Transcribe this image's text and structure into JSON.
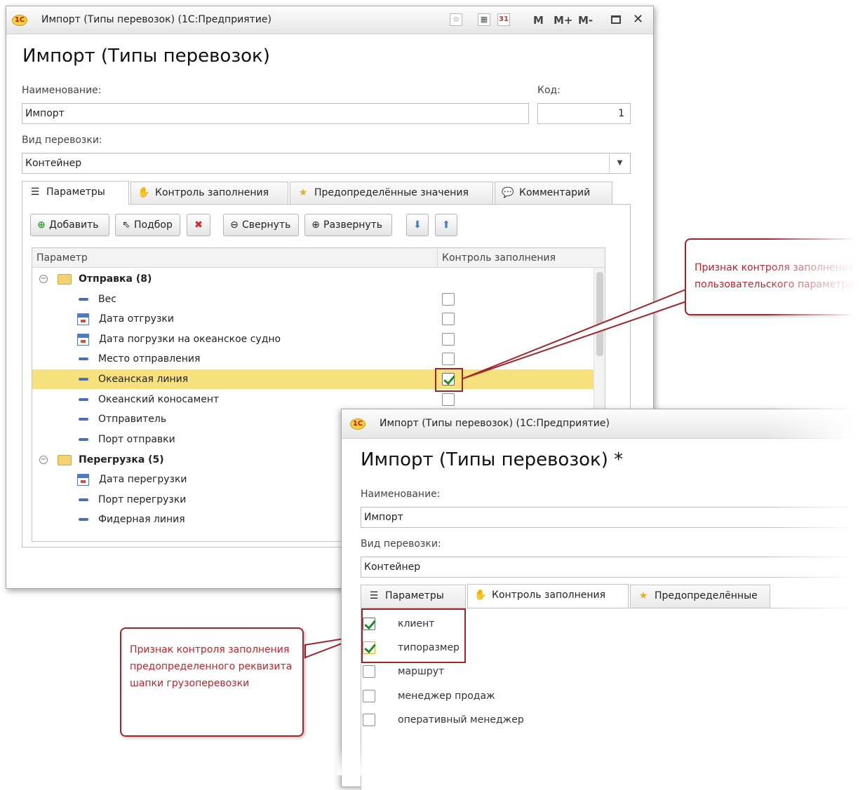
{
  "win1": {
    "title": "Импорт (Типы перевозок)  (1С:Предприятие)",
    "logo": "1С",
    "toolbar": {
      "m": "M",
      "m_plus": "M+",
      "m_minus": "M-",
      "close": "✕",
      "cal_day": "31"
    },
    "heading": "Импорт (Типы перевозок)",
    "name_label": "Наименование:",
    "name_value": "Импорт",
    "code_label": "Код:",
    "code_value": "1",
    "kind_label": "Вид перевозки:",
    "kind_value": "Контейнер",
    "tabs": [
      "Параметры",
      "Контроль заполнения",
      "Предопределённые значения",
      "Комментарий"
    ],
    "buttons": {
      "add": "Добавить",
      "pick": "Подбор",
      "collapse": "Свернуть",
      "expand": "Развернуть"
    },
    "columns": [
      "Параметр",
      "Контроль заполнения"
    ],
    "groups": [
      {
        "label": "Отправка (8)"
      },
      {
        "label": "Перегрузка (5)"
      }
    ],
    "rows": [
      {
        "label": "Вес",
        "icon": "dash",
        "checked": false
      },
      {
        "label": "Дата отгрузки",
        "icon": "calendar",
        "checked": false
      },
      {
        "label": "Дата погрузки на океанское судно",
        "icon": "calendar",
        "checked": false
      },
      {
        "label": "Место отправления",
        "icon": "dash",
        "checked": false
      },
      {
        "label": "Океанская линия",
        "icon": "dash",
        "checked": true,
        "selected": true
      },
      {
        "label": "Океанский коносамент",
        "icon": "dash",
        "checked": false
      },
      {
        "label": "Отправитель",
        "icon": "dash"
      },
      {
        "label": "Порт отправки",
        "icon": "dash"
      },
      {
        "label": "Дата перегрузки",
        "icon": "calendar"
      },
      {
        "label": "Порт перегрузки",
        "icon": "dash"
      },
      {
        "label": "Фидерная линия",
        "icon": "dash"
      }
    ]
  },
  "win2": {
    "title": "Импорт (Типы перевозок)  (1С:Предприятие)",
    "logo": "1С",
    "heading": "Импорт (Типы перевозок) *",
    "name_label": "Наименование:",
    "name_value": "Импорт",
    "kind_label": "Вид перевозки:",
    "kind_value": "Контейнер",
    "tabs": [
      "Параметры",
      "Контроль заполнения",
      "Предопределённые"
    ],
    "items": [
      {
        "label": "клиент",
        "checked": true
      },
      {
        "label": "типоразмер",
        "checked": true
      },
      {
        "label": "маршрут",
        "checked": false
      },
      {
        "label": "менеджер продаж",
        "checked": false
      },
      {
        "label": "оперативный менеджер",
        "checked": false
      }
    ]
  },
  "callouts": {
    "right": "Признак контроля заполнения пользовательского параметра",
    "left": "Признак контроля заполнения предопределенного реквизита шапки грузоперевозки"
  },
  "colors": {
    "accent_red": "#a1262c",
    "selected_row": "#f7e17d",
    "check_green": "#1e8b2e"
  }
}
